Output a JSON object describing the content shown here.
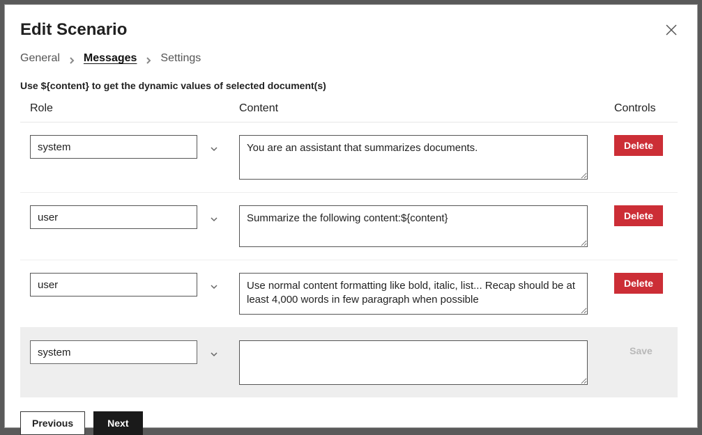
{
  "header": {
    "title": "Edit Scenario"
  },
  "breadcrumb": {
    "items": [
      "General",
      "Messages",
      "Settings"
    ],
    "active_index": 1
  },
  "hint": "Use ${content} to get the dynamic values of selected document(s)",
  "columns": {
    "role": "Role",
    "content": "Content",
    "controls": "Controls"
  },
  "rows": [
    {
      "role": "system",
      "content": "You are an assistant that summarizes documents.",
      "action": "Delete"
    },
    {
      "role": "user",
      "content": "Summarize the following content:${content}",
      "action": "Delete"
    },
    {
      "role": "user",
      "content": "Use normal content formatting like bold, italic, list... Recap should be at least 4,000 words in few paragraph when possible",
      "action": "Delete"
    }
  ],
  "draft": {
    "role": "system",
    "content": "",
    "action": "Save"
  },
  "footer": {
    "previous": "Previous",
    "next": "Next"
  }
}
